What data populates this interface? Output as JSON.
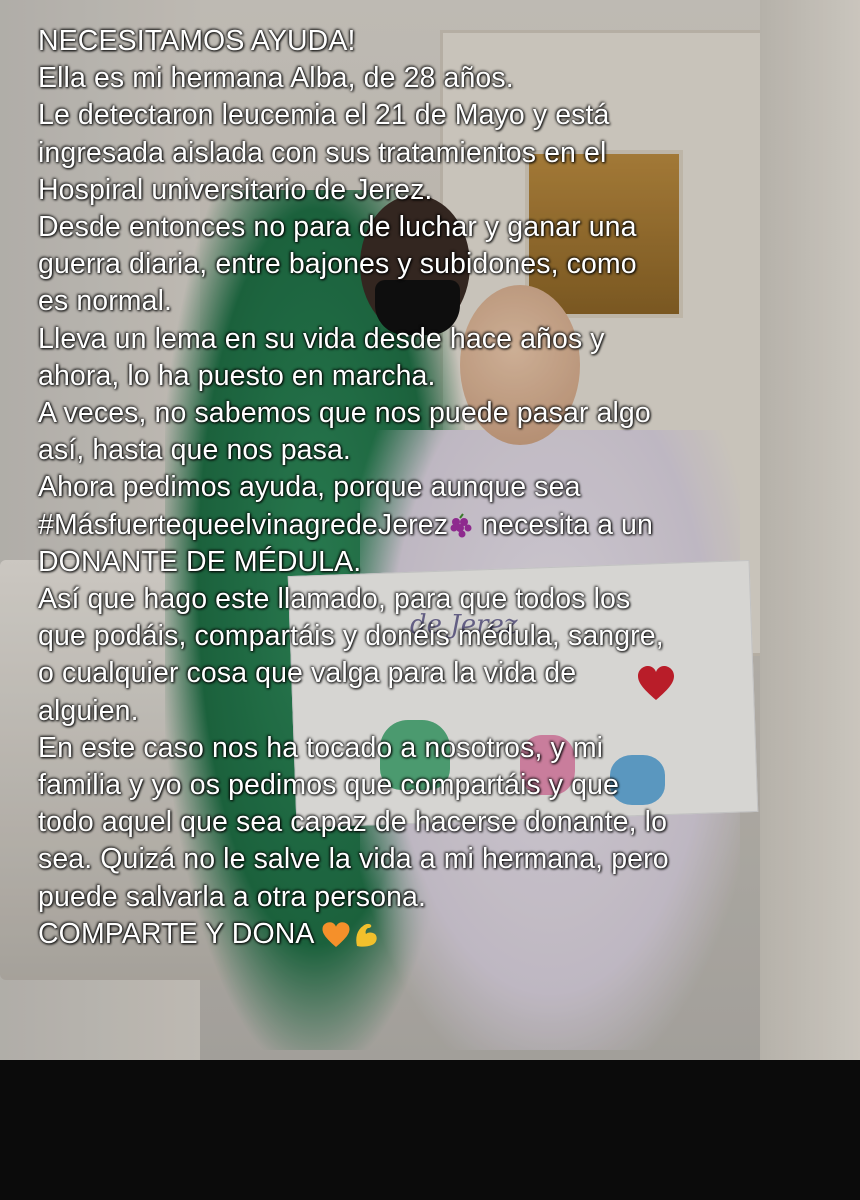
{
  "post": {
    "lines": [
      "NECESITAMOS AYUDA!",
      "Ella es mi hermana Alba, de 28 años.",
      "Le detectaron leucemia el 21 de Mayo y está",
      "ingresada aislada con sus tratamientos en el",
      "Hospiral universitario de Jerez.",
      "Desde entonces no para de luchar y ganar una",
      "guerra diaria, entre bajones y subidones,  como",
      "es normal.",
      "Lleva un lema en su vida desde hace años y",
      "ahora, lo ha puesto en marcha.",
      "A veces, no sabemos que nos puede pasar algo",
      "así, hasta que nos pasa.",
      "Ahora pedimos ayuda, porque aunque sea",
      "#MásfuertequeelvinagredeJerez",
      " necesita a un",
      "DONANTE DE MÉDULA.",
      "Así que hago este llamado, para que todos los",
      "que podáis, compartáis y donéis médula, sangre,",
      "o cualquier cosa que valga para la vida de",
      "alguien.",
      "En este caso nos ha tocado a nosotros, y mi",
      "familia y yo os pedimos que compartáis y que",
      "todo aquel que sea capaz de hacerse donante, lo",
      "sea. Quizá no le salve la vida a mi hermana, pero",
      "puede salvarla a otra persona.",
      "COMPARTE Y DONA"
    ]
  },
  "poster": {
    "handwriting": "de Jerez"
  },
  "icons": {
    "grapes": "grapes-emoji",
    "heart": "orange-heart-emoji",
    "muscle": "flexed-biceps-emoji",
    "poster_heart": "red-heart"
  }
}
